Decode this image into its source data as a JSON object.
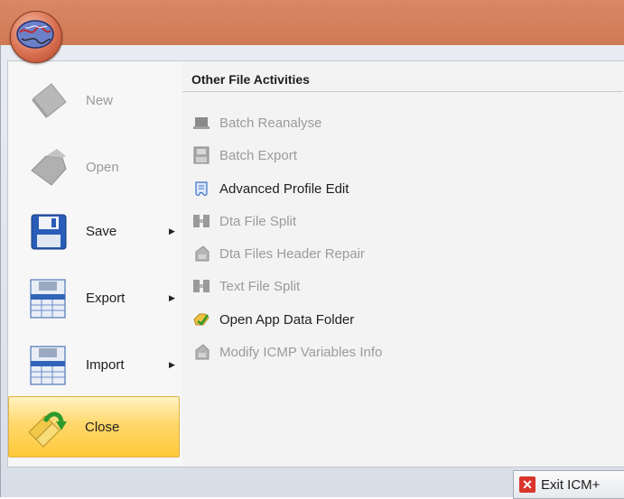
{
  "app": {
    "logo_icon": "brain-icon",
    "ribbon_color": "#d4805c"
  },
  "left_menu": {
    "items": [
      {
        "label": "New",
        "icon": "new-document-icon",
        "enabled": false,
        "submenu": false
      },
      {
        "label": "Open",
        "icon": "open-folder-icon",
        "enabled": false,
        "submenu": false
      },
      {
        "label": "Save",
        "icon": "floppy-disk-icon",
        "enabled": true,
        "submenu": true
      },
      {
        "label": "Export",
        "icon": "export-table-icon",
        "enabled": true,
        "submenu": true
      },
      {
        "label": "Import",
        "icon": "import-table-icon",
        "enabled": true,
        "submenu": true
      },
      {
        "label": "Close",
        "icon": "close-arrow-icon",
        "enabled": true,
        "submenu": false,
        "highlighted": true
      }
    ]
  },
  "right_panel": {
    "title": "Other File Activities",
    "items": [
      {
        "label": "Batch Reanalyse",
        "icon": "batch-icon",
        "enabled": false
      },
      {
        "label": "Batch Export",
        "icon": "batch-export-icon",
        "enabled": false
      },
      {
        "label": "Advanced Profile Edit",
        "icon": "profile-edit-icon",
        "enabled": true
      },
      {
        "label": "Dta File Split",
        "icon": "file-split-icon",
        "enabled": false
      },
      {
        "label": "Dta Files Header Repair",
        "icon": "header-repair-icon",
        "enabled": false
      },
      {
        "label": "Text File Split",
        "icon": "text-split-icon",
        "enabled": false
      },
      {
        "label": "Open App Data Folder",
        "icon": "folder-icon",
        "enabled": true
      },
      {
        "label": "Modify ICMP Variables Info",
        "icon": "variables-info-icon",
        "enabled": false
      }
    ]
  },
  "footer": {
    "exit_label": "Exit ICM+",
    "exit_icon": "close-x-icon"
  }
}
